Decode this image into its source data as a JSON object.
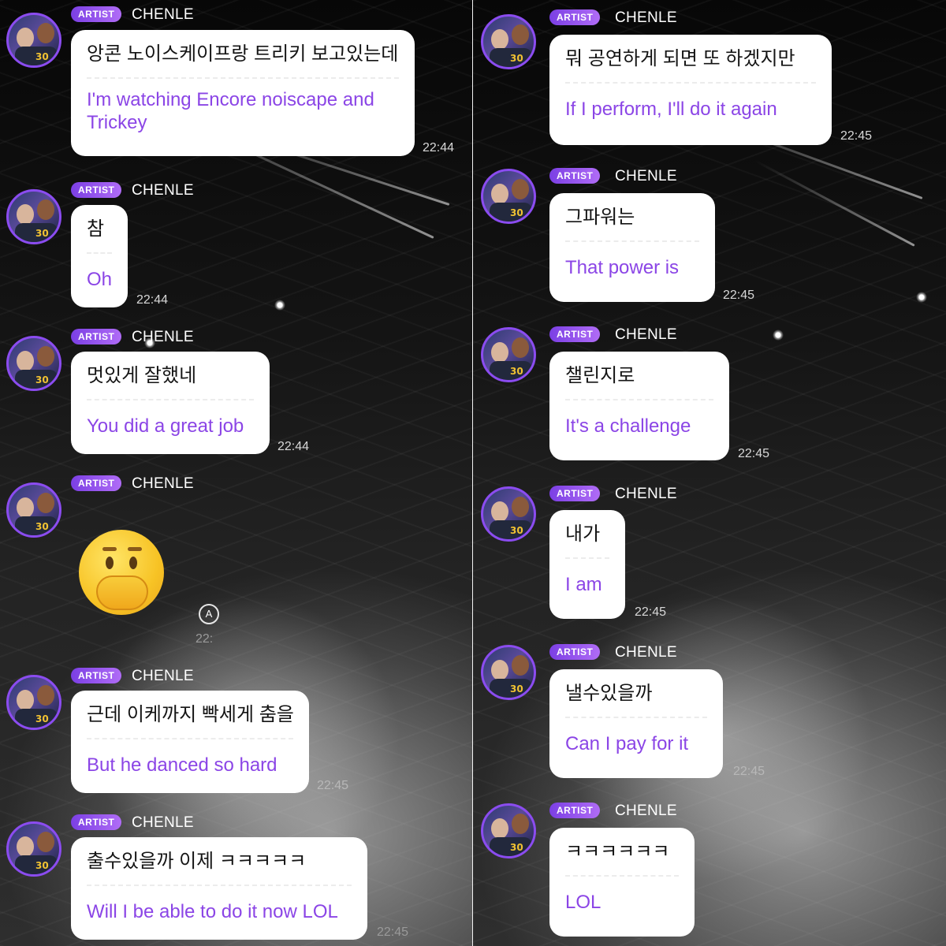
{
  "badge_label": "ARTIST",
  "sender_name": "CHENLE",
  "avatar_icon": "user-photo-avatar",
  "emoji_icon": "face-with-hand-over-mouth",
  "translate_icon_glyph": "A",
  "colors": {
    "accent": "#8b45e6",
    "badge_start": "#7b3fe4",
    "badge_end": "#b06cf6",
    "bubble": "#ffffff"
  },
  "left_column": [
    {
      "ko": "앙콘 노이스케이프랑 트리키 보고있는데",
      "en": "I'm watching Encore noiscape and Trickey",
      "time": "22:44"
    },
    {
      "ko": "참",
      "en": "Oh",
      "time": "22:44"
    },
    {
      "ko": "멋있게 잘했네",
      "en": "You did a great job",
      "time": "22:44"
    },
    {
      "emoji": "🤭",
      "time": "22:"
    },
    {
      "ko": "근데 이케까지 빡세게 춤을",
      "en": "But he danced so hard",
      "time": "22:45"
    },
    {
      "ko": "출수있을까 이제 ㅋㅋㅋㅋㅋ",
      "en": "Will I be able to do it now LOL",
      "time": "22:45"
    }
  ],
  "right_column": [
    {
      "ko": "뭐 공연하게 되면 또 하겠지만",
      "en": "If I perform, I'll do it again",
      "time": "22:45"
    },
    {
      "ko": "그파워는",
      "en": "That power is",
      "time": "22:45"
    },
    {
      "ko": "챌린지로",
      "en": "It's a challenge",
      "time": "22:45"
    },
    {
      "ko": "내가",
      "en": "I am",
      "time": "22:45"
    },
    {
      "ko": "낼수있을까",
      "en": "Can I pay for it",
      "time": "22:45"
    },
    {
      "ko": "ㅋㅋㅋㅋㅋㅋ",
      "en": "LOL",
      "time": ""
    }
  ]
}
